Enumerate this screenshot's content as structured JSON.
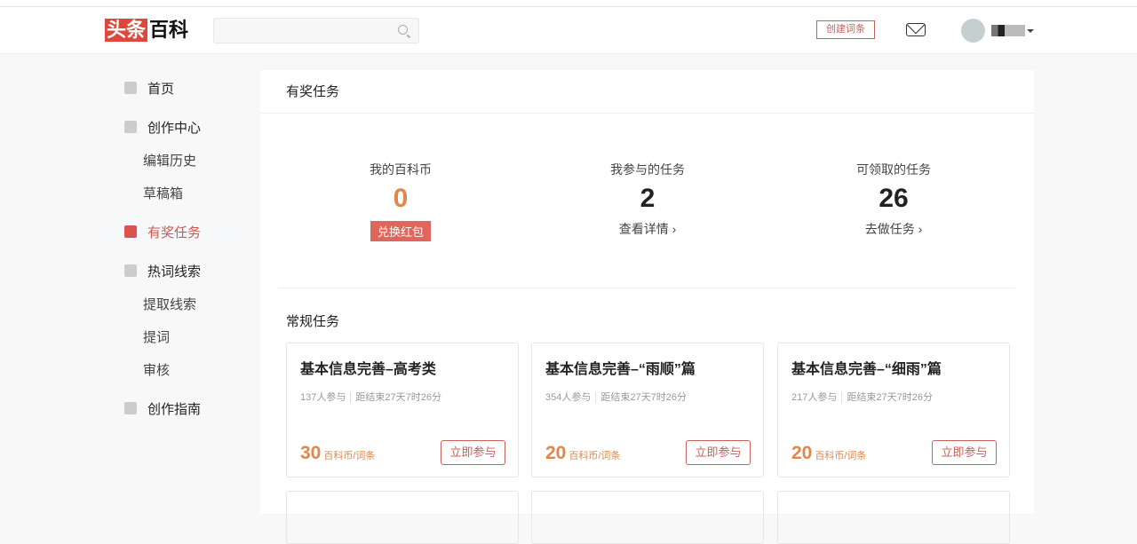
{
  "header": {
    "logo_a": "头条",
    "logo_b": "百科",
    "search_placeholder": "",
    "create_label": "创建词条"
  },
  "sidebar": [
    {
      "label": "首页",
      "type": "main"
    },
    {
      "label": "创作中心",
      "type": "main"
    },
    {
      "label": "编辑历史",
      "type": "sub"
    },
    {
      "label": "草稿箱",
      "type": "sub"
    },
    {
      "label": "有奖任务",
      "type": "active"
    },
    {
      "label": "热词线索",
      "type": "main"
    },
    {
      "label": "提取线索",
      "type": "sub"
    },
    {
      "label": "提词",
      "type": "sub"
    },
    {
      "label": "审核",
      "type": "sub"
    },
    {
      "label": "创作指南",
      "type": "main"
    }
  ],
  "main": {
    "title": "有奖任务",
    "stats": [
      {
        "label": "我的百科币",
        "value": "0",
        "action": "兑换红包"
      },
      {
        "label": "我参与的任务",
        "value": "2",
        "action": "查看详情 ›"
      },
      {
        "label": "可领取的任务",
        "value": "26",
        "action": "去做任务 ›"
      }
    ],
    "section": "常规任务",
    "tasks": [
      {
        "title": "基本信息完善–高考类",
        "participants": "137人参与",
        "remaining": "距结束27天7时26分",
        "points": "30",
        "unit": "百科币/词条",
        "button": "立即参与"
      },
      {
        "title": "基本信息完善–“雨顺”篇",
        "participants": "354人参与",
        "remaining": "距结束27天7时26分",
        "points": "20",
        "unit": "百科币/词条",
        "button": "立即参与"
      },
      {
        "title": "基本信息完善–“细雨”篇",
        "participants": "217人参与",
        "remaining": "距结束27天7时26分",
        "points": "20",
        "unit": "百科币/词条",
        "button": "立即参与"
      }
    ]
  },
  "colors": {
    "accent": "#d9534f",
    "points": "#e0874b"
  }
}
